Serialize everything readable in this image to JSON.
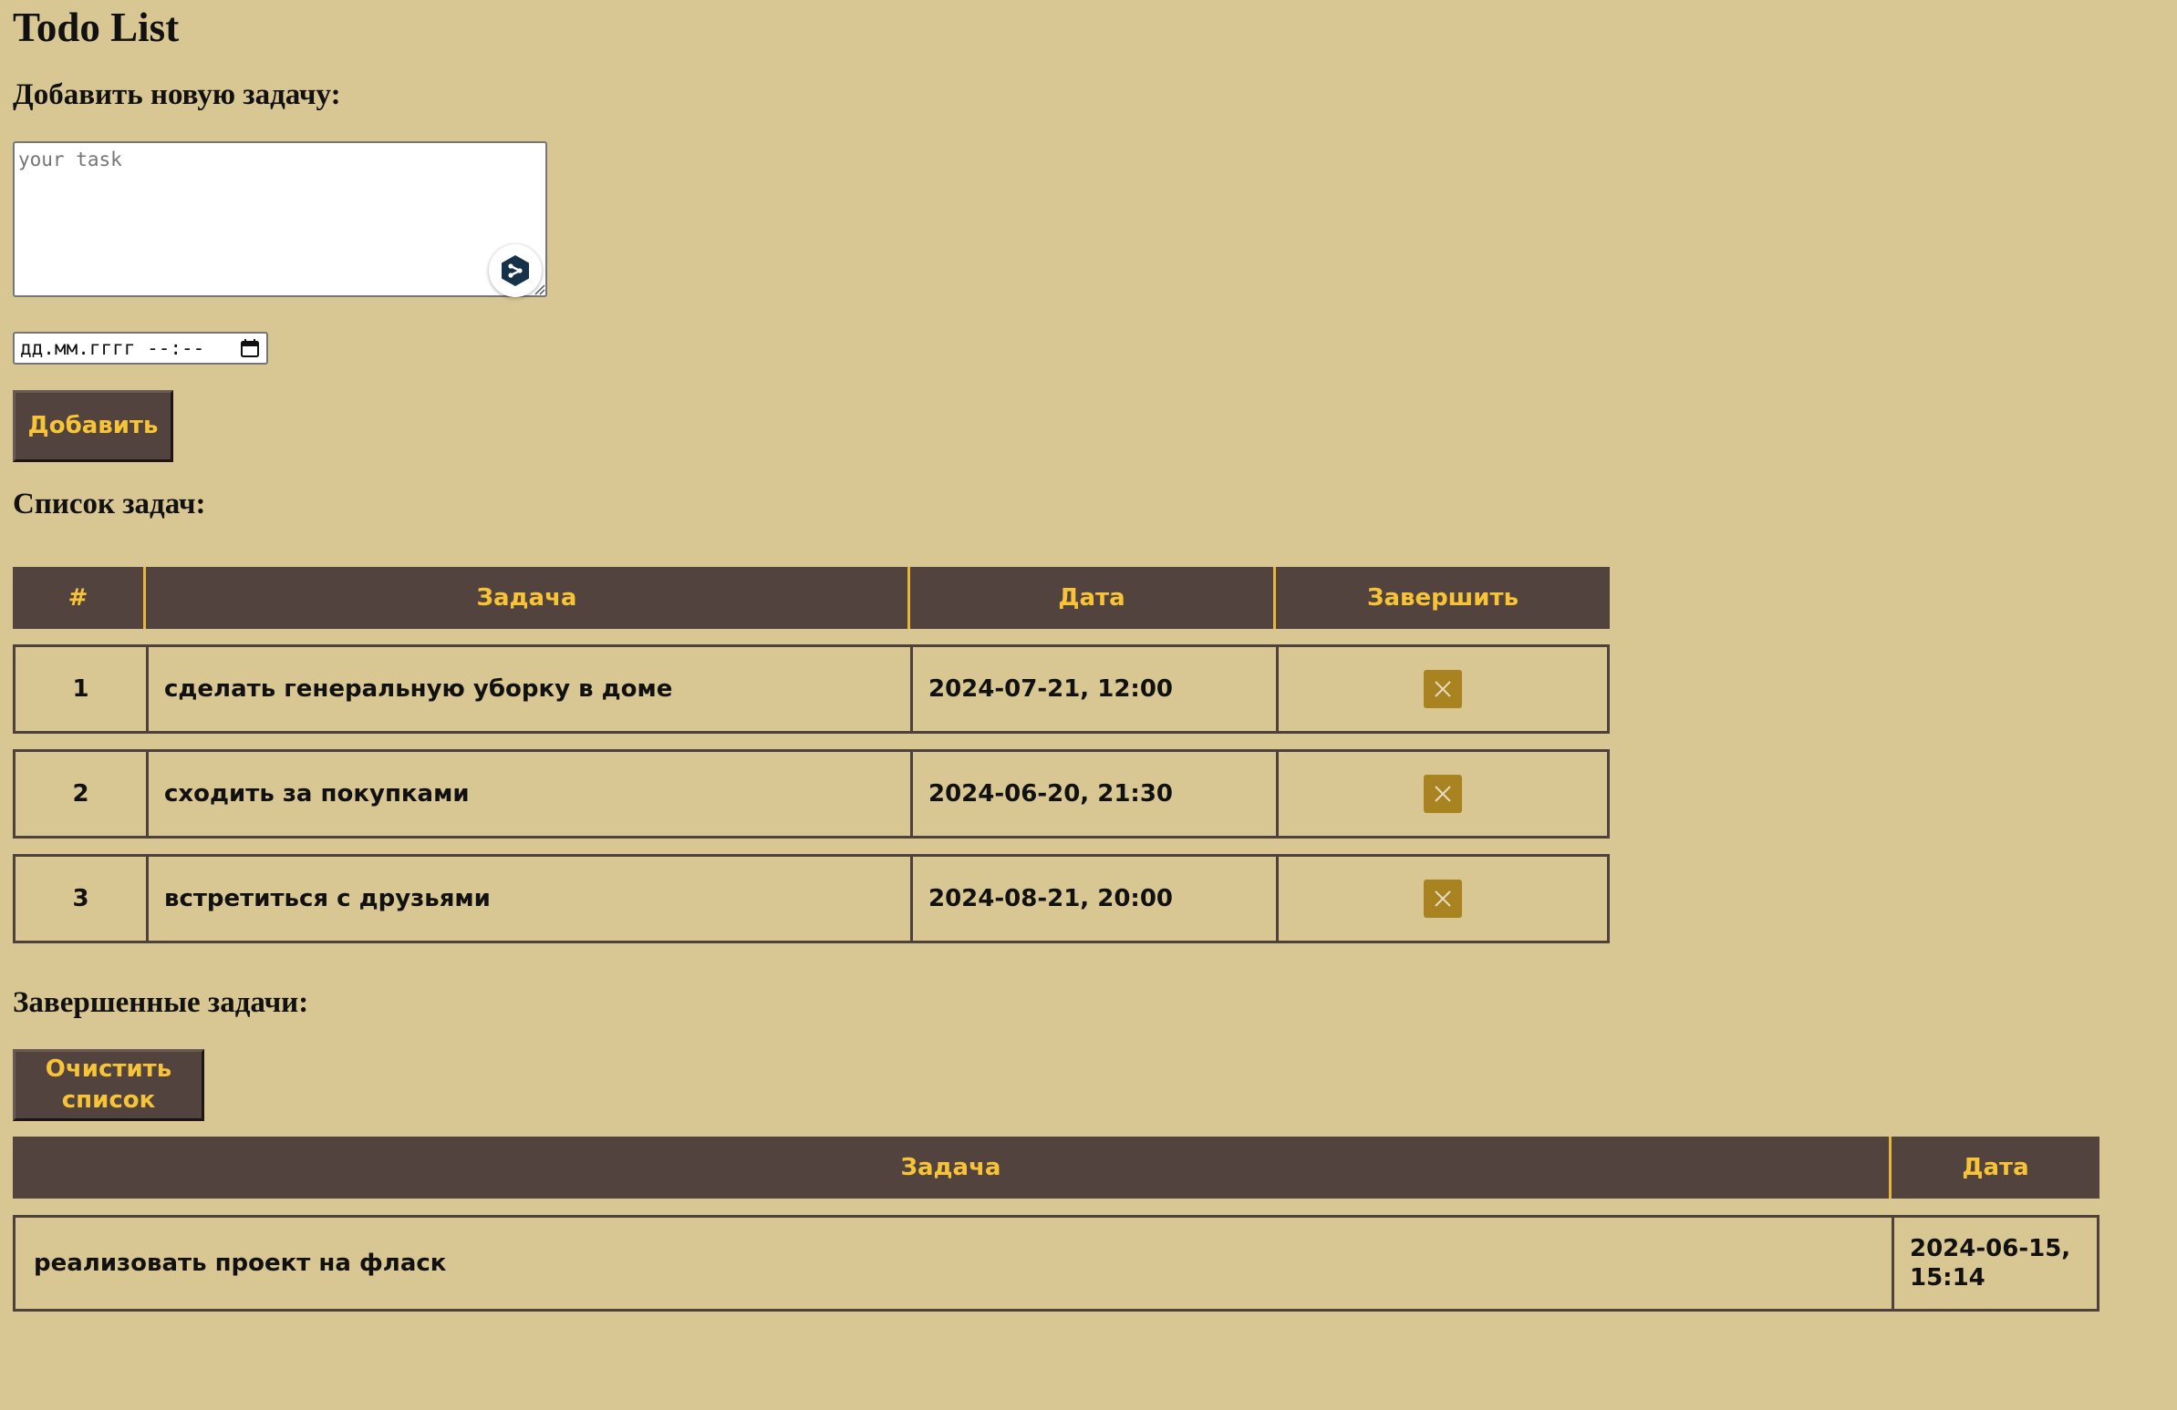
{
  "title": "Todo List",
  "add_section": {
    "heading": "Добавить новую задачу:",
    "task_placeholder": "your task",
    "datetime_placeholder": "дд.мм.гггг --:--",
    "add_button": "Добавить"
  },
  "tasks_section": {
    "heading": "Список задач:",
    "columns": [
      "#",
      "Задача",
      "Дата",
      "Завершить"
    ],
    "rows": [
      {
        "num": "1",
        "task": "сделать генеральную уборку в доме",
        "date": "2024-07-21, 12:00"
      },
      {
        "num": "2",
        "task": "сходить за покупками",
        "date": "2024-06-20, 21:30"
      },
      {
        "num": "3",
        "task": "встретиться с друзьями",
        "date": "2024-08-21, 20:00"
      }
    ]
  },
  "completed_section": {
    "heading": "Завершенные задачи:",
    "clear_button": "Очистить список",
    "columns": [
      "Задача",
      "Дата"
    ],
    "rows": [
      {
        "task": "реализовать проект на фласк",
        "date": "2024-06-15, 15:14"
      }
    ]
  },
  "colors": {
    "background": "#d9c793",
    "header_bg": "#53433e",
    "header_text": "#f7c438",
    "complete_button": "#a8831f"
  },
  "icons": {
    "complete": "close-icon",
    "calendar": "calendar-icon",
    "extension": "share-extension-icon"
  }
}
